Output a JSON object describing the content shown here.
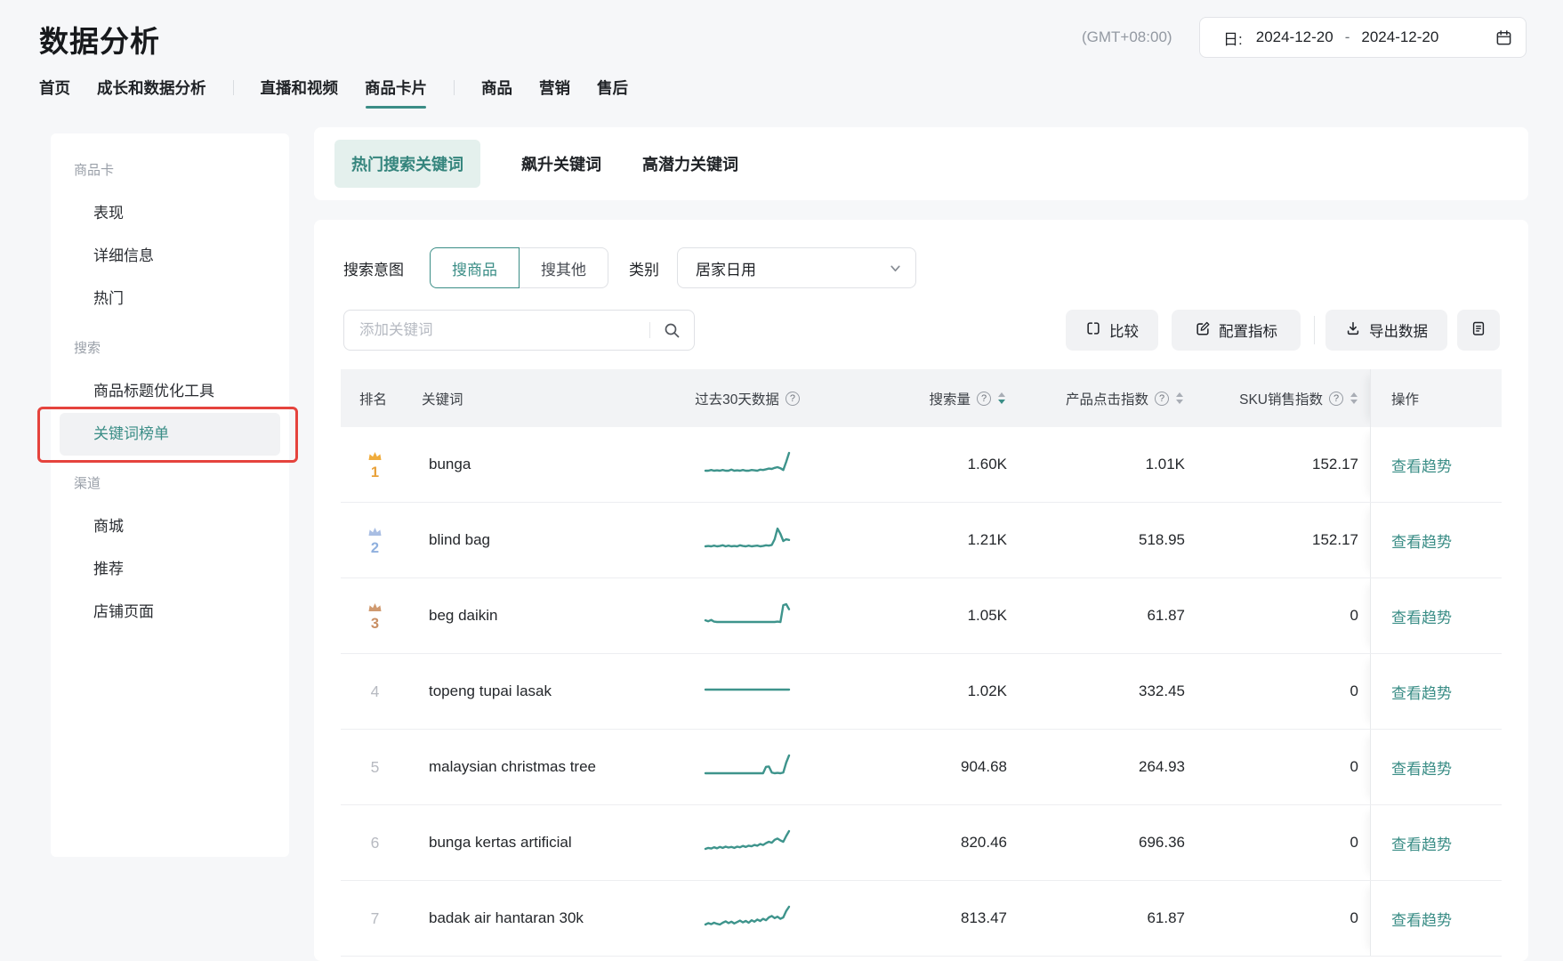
{
  "colors": {
    "accent": "#3A8D86",
    "accent_bg": "#E4F0ED",
    "sparkline": "#3E948C",
    "annotation_red": "#E5433D",
    "medal_crown": {
      "gold": "#F0AC3C",
      "silver": "#A9BEE3",
      "bronze": "#D09A70"
    },
    "medal_number": {
      "gold": "#E9A23B",
      "silver": "#8FB0DE",
      "bronze": "#C98F64"
    }
  },
  "header": {
    "title": "数据分析",
    "timezone": "(GMT+08:00)",
    "date": {
      "label": "日:",
      "start": "2024-12-20",
      "separator": "-",
      "end": "2024-12-20"
    }
  },
  "nav": {
    "items": [
      {
        "label": "首页"
      },
      {
        "label": "成长和数据分析"
      },
      {
        "divider": true
      },
      {
        "label": "直播和视频"
      },
      {
        "label": "商品卡片",
        "selected": true
      },
      {
        "divider": true
      },
      {
        "label": "商品"
      },
      {
        "label": "营销"
      },
      {
        "label": "售后"
      }
    ]
  },
  "sidebar": {
    "sections": [
      {
        "label": "商品卡",
        "items": [
          {
            "label": "表现"
          },
          {
            "label": "详细信息"
          },
          {
            "label": "热门"
          }
        ]
      },
      {
        "label": "搜索",
        "items": [
          {
            "label": "商品标题优化工具"
          },
          {
            "label": "关键词榜单",
            "selected": true,
            "annotated": true
          }
        ]
      },
      {
        "label": "渠道",
        "items": [
          {
            "label": "商城"
          },
          {
            "label": "推荐"
          },
          {
            "label": "店铺页面"
          }
        ]
      }
    ]
  },
  "tabs": [
    {
      "label": "热门搜索关键词",
      "selected": true
    },
    {
      "label": "飙升关键词"
    },
    {
      "label": "高潜力关键词"
    }
  ],
  "filters": {
    "search_intent": {
      "label": "搜索意图",
      "options": [
        {
          "label": "搜商品",
          "selected": true
        },
        {
          "label": "搜其他"
        }
      ]
    },
    "category": {
      "label": "类别",
      "value": "居家日用"
    }
  },
  "toolbar": {
    "search_placeholder": "添加关键词",
    "compare_label": "比较",
    "configure_label": "配置指标",
    "export_label": "导出数据"
  },
  "table": {
    "columns": [
      {
        "key": "rank",
        "label": "排名"
      },
      {
        "key": "keyword",
        "label": "关键词"
      },
      {
        "key": "trend",
        "label": "过去30天数据",
        "help": true
      },
      {
        "key": "search_volume",
        "label": "搜索量",
        "help": true,
        "sortable": true,
        "sort": "desc"
      },
      {
        "key": "click_index",
        "label": "产品点击指数",
        "help": true,
        "sortable": true
      },
      {
        "key": "sku_sales_index",
        "label": "SKU销售指数",
        "help": true,
        "sortable": true
      },
      {
        "key": "action",
        "label": "操作"
      }
    ],
    "action_label": "查看趋势",
    "rows": [
      {
        "rank": 1,
        "medal": "gold",
        "keyword": "bunga",
        "search_volume": "1.60K",
        "click_index": "1.01K",
        "sku_sales_index": "152.17",
        "trend": [
          5,
          5,
          5.2,
          5,
          5.1,
          5,
          5.2,
          5,
          5,
          5.3,
          5,
          5.1,
          5,
          5.2,
          5,
          5,
          5.2,
          5.1,
          5,
          5.3,
          5.2,
          5.4,
          5.6,
          5.5,
          5.8,
          6,
          5.7,
          5.2,
          7.5,
          10
        ]
      },
      {
        "rank": 2,
        "medal": "silver",
        "keyword": "blind bag",
        "search_volume": "1.21K",
        "click_index": "518.95",
        "sku_sales_index": "152.17",
        "trend": [
          5,
          5.1,
          5,
          5.2,
          5,
          5.1,
          5.3,
          5,
          5.2,
          5,
          5.1,
          5,
          5.3,
          5.1,
          5,
          5.2,
          5,
          5.1,
          5.2,
          5,
          5.1,
          5.3,
          5.2,
          5.4,
          7,
          10,
          8.5,
          6.5,
          7,
          6.8
        ]
      },
      {
        "rank": 3,
        "medal": "bronze",
        "keyword": "beg daikin",
        "search_volume": "1.05K",
        "click_index": "61.87",
        "sku_sales_index": "0",
        "trend": [
          5.5,
          5.2,
          5.6,
          5.1,
          5,
          5,
          5,
          5,
          5,
          5,
          5,
          5,
          5,
          5,
          5,
          5,
          5,
          5,
          5,
          5,
          5,
          5,
          5,
          5,
          5,
          5.1,
          5,
          10,
          10.3,
          8.8
        ]
      },
      {
        "rank": 4,
        "keyword": "topeng tupai lasak",
        "search_volume": "1.02K",
        "click_index": "332.45",
        "sku_sales_index": "0",
        "trend": [
          5,
          5,
          5,
          5,
          5,
          5,
          5,
          5,
          5,
          5,
          5,
          5,
          5,
          5,
          5,
          5,
          5,
          5,
          5,
          5,
          5,
          5,
          5,
          5,
          5,
          5,
          5,
          5,
          5,
          5
        ]
      },
      {
        "rank": 5,
        "keyword": "malaysian christmas tree",
        "search_volume": "904.68",
        "click_index": "264.93",
        "sku_sales_index": "0",
        "trend": [
          5,
          5,
          5,
          5,
          5,
          5,
          5,
          5,
          5,
          5,
          5,
          5,
          5,
          5,
          5,
          5,
          5,
          5,
          5,
          5,
          5,
          6.8,
          6.9,
          5.2,
          5,
          5.1,
          5,
          5.2,
          8,
          10
        ]
      },
      {
        "rank": 6,
        "keyword": "bunga kertas artificial",
        "search_volume": "820.46",
        "click_index": "696.36",
        "sku_sales_index": "0",
        "trend": [
          5,
          5.3,
          5.1,
          5.5,
          5.2,
          5.6,
          5.3,
          5.7,
          5.4,
          5.6,
          5.3,
          5.7,
          5.5,
          5.9,
          5.6,
          6,
          5.8,
          6.2,
          6,
          6.5,
          6.2,
          6.8,
          7.2,
          6.9,
          7.8,
          8.2,
          7.6,
          7.2,
          9,
          10.5
        ]
      },
      {
        "rank": 7,
        "keyword": "badak air hantaran 30k",
        "search_volume": "813.47",
        "click_index": "61.87",
        "sku_sales_index": "0",
        "trend": [
          5,
          5.4,
          5.1,
          5.5,
          5.2,
          5,
          5.5,
          5.9,
          5.4,
          5.8,
          5.3,
          5.7,
          6.1,
          5.6,
          6,
          5.5,
          6.2,
          5.8,
          6.4,
          6,
          6.6,
          6.2,
          7,
          7.4,
          6.8,
          7.2,
          6.6,
          7,
          8.8,
          10
        ]
      }
    ]
  }
}
